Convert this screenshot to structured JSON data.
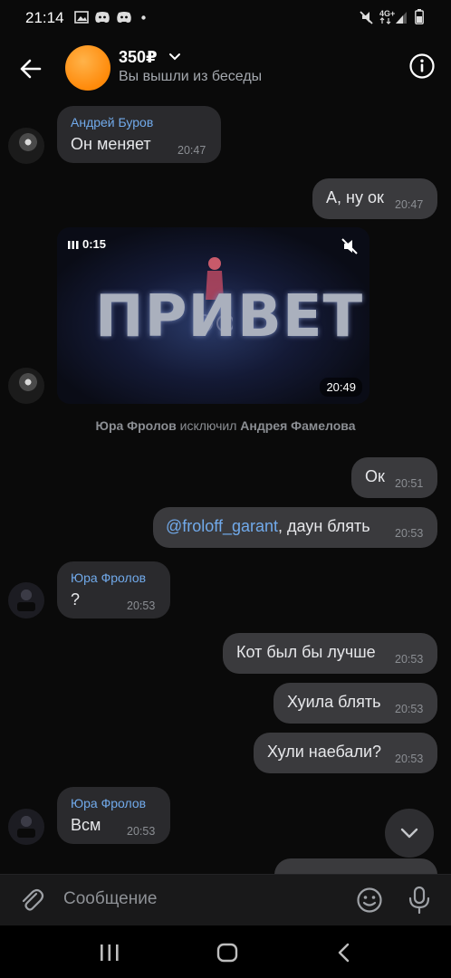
{
  "status_bar": {
    "time": "21:14",
    "network": "4G+"
  },
  "header": {
    "title": "350₽",
    "subtitle": "Вы вышли из беседы"
  },
  "messages": [
    {
      "sender": "Андрей Буров",
      "text": "Он меняет",
      "time": "20:47"
    },
    {
      "text": "А, ну ок",
      "time": "20:47"
    },
    {
      "video_duration": "0:15",
      "video_word": "ПРИВЕТ",
      "time": "20:49"
    },
    {
      "system_actor": "Юра Фролов",
      "system_action": "исключил",
      "system_target": "Андрея Фамелова"
    },
    {
      "text": "Ок",
      "time": "20:51"
    },
    {
      "mention": "@froloff_garant",
      "text": ", даун блять",
      "time": "20:53"
    },
    {
      "sender": "Юра Фролов",
      "text": "?",
      "time": "20:53"
    },
    {
      "text": "Кот был бы лучше",
      "time": "20:53"
    },
    {
      "text": "Хуила блять",
      "time": "20:53"
    },
    {
      "text": "Хули наебали?",
      "time": "20:53"
    },
    {
      "sender": "Юра Фролов",
      "text": "Всм",
      "time": "20:53"
    }
  ],
  "composer": {
    "placeholder": "Сообщение"
  },
  "icons": {
    "back": "arrow-left-icon",
    "info": "info-icon",
    "attach": "paperclip-icon",
    "emoji": "smile-icon",
    "mic": "microphone-icon",
    "scroll": "chevron-down-icon"
  },
  "colors": {
    "accent": "#71aaeb",
    "avatar_orange": "#ff9a1f",
    "background": "#0a0a0a"
  }
}
